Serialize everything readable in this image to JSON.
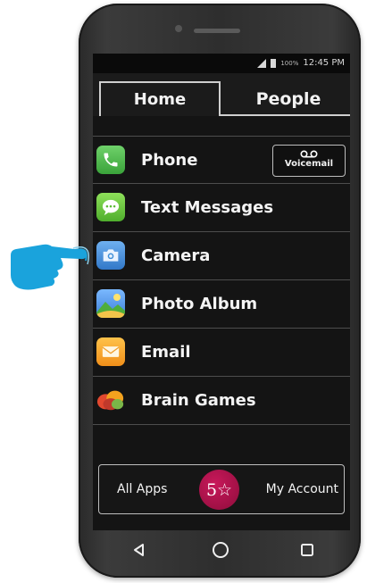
{
  "status_bar": {
    "battery_percent": "100%",
    "time": "12:45 PM"
  },
  "tabs": [
    {
      "label": "Home",
      "active": true
    },
    {
      "label": "People",
      "active": false
    }
  ],
  "apps": [
    {
      "label": "Phone",
      "icon": "phone-icon"
    },
    {
      "label": "Text Messages",
      "icon": "text-messages-icon"
    },
    {
      "label": "Camera",
      "icon": "camera-icon"
    },
    {
      "label": "Photo Album",
      "icon": "photo-album-icon"
    },
    {
      "label": "Email",
      "icon": "email-icon"
    },
    {
      "label": "Brain Games",
      "icon": "brain-games-icon"
    }
  ],
  "voicemail": {
    "label": "Voicemail",
    "icon": "voicemail-icon"
  },
  "bottom_bar": {
    "all_apps_label": "All Apps",
    "logo_text": "5☆",
    "my_account_label": "My Account"
  },
  "nav": [
    "back-icon",
    "home-icon",
    "recents-icon"
  ],
  "colors": {
    "phone": "#4caf50",
    "text_messages": "#6ccf3a",
    "camera": "#3f8fd8",
    "email": "#f5a623",
    "logo": "#b3124f",
    "pointer_hand": "#1aa3dc"
  }
}
